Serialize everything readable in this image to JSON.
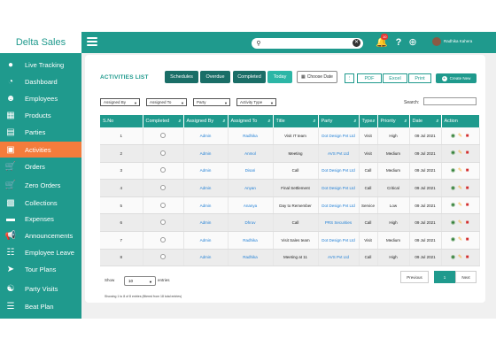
{
  "brand": "Delta Sales",
  "header": {
    "notification_count": "10",
    "user_name": "Radhika Kahera"
  },
  "sidebar": {
    "items": [
      {
        "label": "Live Tracking",
        "icon": "location-pin-icon"
      },
      {
        "label": "Dashboard",
        "icon": "gauge-icon"
      },
      {
        "label": "Employees",
        "icon": "users-icon"
      },
      {
        "label": "Products",
        "icon": "grid-icon"
      },
      {
        "label": "Parties",
        "icon": "building-icon"
      },
      {
        "label": "Activities",
        "icon": "document-icon"
      },
      {
        "label": "Orders",
        "icon": "cart-icon"
      },
      {
        "label": "Zero Orders",
        "icon": "cart-icon"
      },
      {
        "label": "Collections",
        "icon": "cash-icon"
      },
      {
        "label": "Expenses",
        "icon": "wallet-icon"
      },
      {
        "label": "Announcements",
        "icon": "megaphone-icon"
      },
      {
        "label": "Employee Leave",
        "icon": "calendar-icon"
      },
      {
        "label": "Tour Plans",
        "icon": "plane-icon"
      },
      {
        "label": "Party Visits",
        "icon": "handshake-icon"
      },
      {
        "label": "Beat Plan",
        "icon": "list-icon"
      }
    ],
    "active_index": 5
  },
  "page": {
    "title": "ACTIVITIES LIST",
    "tabs": [
      "Schedules",
      "Overdue",
      "Completed",
      "Today"
    ],
    "choose_date": "Choose Date",
    "export": [
      "PDF",
      "Excel",
      "Print"
    ],
    "create_label": "Create New",
    "filters": [
      "Assigned By",
      "Assigned To",
      "Party",
      "Activity Type"
    ],
    "search_label": "Search:"
  },
  "table": {
    "columns": [
      "S.No",
      "Completed",
      "Assigned By",
      "Assigned To",
      "Title",
      "Party",
      "Type",
      "Priority",
      "Date",
      "Action"
    ],
    "rows": [
      {
        "sno": "1",
        "by": "Admin",
        "to": "Radhika",
        "title": "Visit IT team",
        "party": "Dot Design Pvt Ltd",
        "type": "Visit",
        "priority": "High",
        "date": "09 Jul 2021"
      },
      {
        "sno": "2",
        "by": "Admin",
        "to": "Anmol",
        "title": "Meeting",
        "party": "AVS Pvt Ltd",
        "type": "Visit",
        "priority": "Medium",
        "date": "09 Jul 2021"
      },
      {
        "sno": "3",
        "by": "Admin",
        "to": "Disari",
        "title": "Call",
        "party": "Dot Design Pvt Ltd",
        "type": "Call",
        "priority": "Medium",
        "date": "09 Jul 2021"
      },
      {
        "sno": "4",
        "by": "Admin",
        "to": "Anyan",
        "title": "Final Settlement",
        "party": "Dot Design Pvt Ltd",
        "type": "Call",
        "priority": "Critical",
        "date": "09 Jul 2021"
      },
      {
        "sno": "5",
        "by": "Admin",
        "to": "Ananya",
        "title": "Day to Remember",
        "party": "Dot Design Pvt Ltd",
        "type": "Service",
        "priority": "Low",
        "date": "09 Jul 2021"
      },
      {
        "sno": "6",
        "by": "Admin",
        "to": "Dhruv",
        "title": "Call",
        "party": "PRS Securities",
        "type": "Call",
        "priority": "High",
        "date": "09 Jul 2021"
      },
      {
        "sno": "7",
        "by": "Admin",
        "to": "Radhika",
        "title": "Visit Sales team",
        "party": "Dot Design Pvt Ltd",
        "type": "Visit",
        "priority": "Medium",
        "date": "09 Jul 2021"
      },
      {
        "sno": "8",
        "by": "Admin",
        "to": "Radhika",
        "title": "Meeting at 11",
        "party": "AVS Pvt Ltd",
        "type": "Call",
        "priority": "High",
        "date": "09 Jul 2021"
      }
    ]
  },
  "footer": {
    "show_label": "Show",
    "show_value": "10",
    "entries_label": "entries",
    "info": "Showing 1 to 8 of 8 entries (filtered from 18 total entries)",
    "prev": "Previous",
    "page": "1",
    "next": "Next"
  },
  "colors": {
    "primary": "#1f9a8d",
    "accent_active": "#f47c3c",
    "link": "#1f7fd6"
  }
}
